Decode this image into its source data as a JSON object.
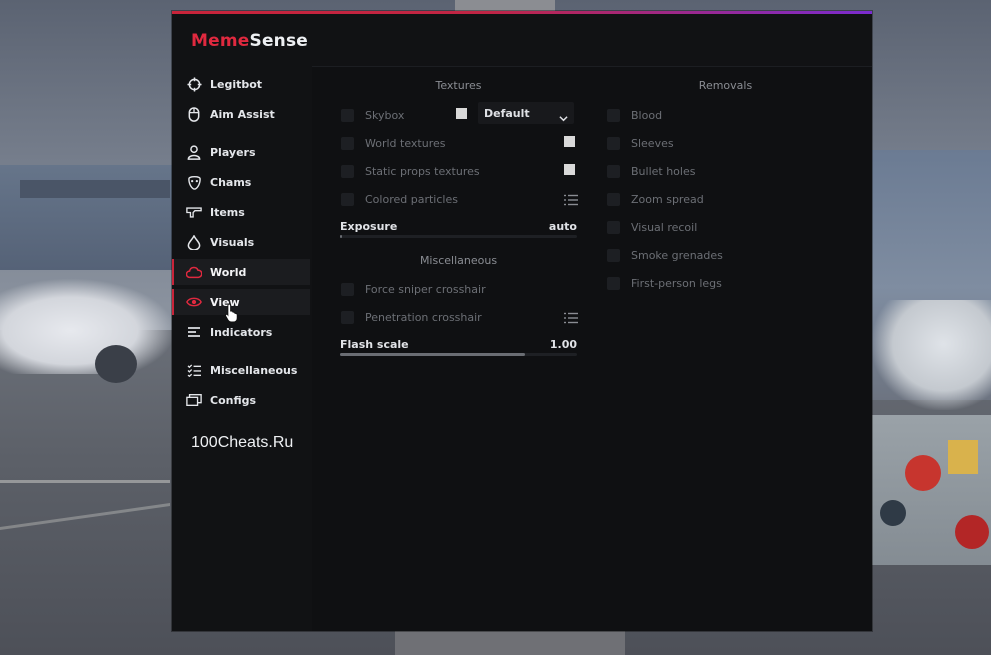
{
  "brand": {
    "part1": "Meme",
    "part2": "Sense",
    "accent": "#e0293f"
  },
  "sidebar": {
    "items": [
      {
        "label": "Legitbot",
        "icon": "crosshair-icon",
        "active": false
      },
      {
        "label": "Aim Assist",
        "icon": "mouse-icon",
        "active": false
      },
      {
        "label": "Players",
        "icon": "person-icon",
        "active": false
      },
      {
        "label": "Chams",
        "icon": "mask-icon",
        "active": false
      },
      {
        "label": "Items",
        "icon": "gun-icon",
        "active": false
      },
      {
        "label": "Visuals",
        "icon": "drop-icon",
        "active": false
      },
      {
        "label": "World",
        "icon": "cloud-icon",
        "active": true
      },
      {
        "label": "View",
        "icon": "eye-icon",
        "active": true
      },
      {
        "label": "Indicators",
        "icon": "lines-icon",
        "active": false
      },
      {
        "label": "Miscellaneous",
        "icon": "checklist-icon",
        "active": false
      },
      {
        "label": "Configs",
        "icon": "folders-icon",
        "active": false
      }
    ],
    "watermark": "100Cheats.Ru"
  },
  "textures": {
    "title": "Textures",
    "skybox_label": "Skybox",
    "skybox_value": "Default",
    "world_textures": "World textures",
    "static_props": "Static props textures",
    "colored_particles": "Colored particles",
    "exposure_label": "Exposure",
    "exposure_value": "auto",
    "exposure_fill": 0.01
  },
  "misc": {
    "title": "Miscellaneous",
    "force_sniper": "Force sniper crosshair",
    "penetration": "Penetration crosshair",
    "flash_label": "Flash scale",
    "flash_value": "1.00",
    "flash_fill": 0.78
  },
  "removals": {
    "title": "Removals",
    "items": [
      "Blood",
      "Sleeves",
      "Bullet holes",
      "Zoom spread",
      "Visual recoil",
      "Smoke grenades",
      "First-person legs"
    ]
  }
}
